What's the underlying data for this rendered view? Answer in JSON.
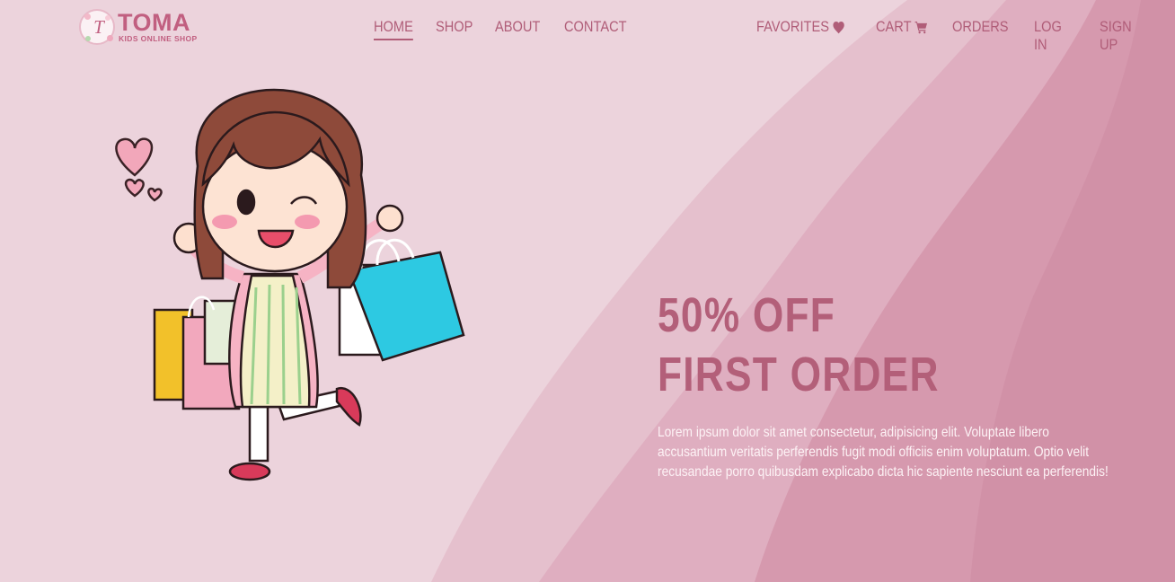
{
  "brand": {
    "name": "TOMA",
    "tagline": "KIDS ONLINE SHOP",
    "logo_letter": "T"
  },
  "nav": {
    "main": [
      {
        "label": "HOME",
        "active": true
      },
      {
        "label": "SHOP"
      },
      {
        "label": "ABOUT"
      },
      {
        "label": "CONTACT"
      }
    ],
    "account": [
      {
        "label": "FAVORITES",
        "icon": "heart-icon"
      },
      {
        "label": "CART",
        "icon": "cart-icon"
      },
      {
        "label": "ORDERS"
      },
      {
        "label": "LOG IN"
      },
      {
        "label": "SIGN UP"
      }
    ]
  },
  "hero": {
    "headline_line1": "50% OFF",
    "headline_line2": "FIRST ORDER",
    "body": "Lorem ipsum dolor sit amet consectetur, adipisicing elit. Voluptate libero accusantium veritatis perferendis fugit modi officiis enim voluptatum. Optio velit recusandae porro quibusdam explicabo dicta hic sapiente nesciunt ea perferendis!",
    "illustration": "girl-with-shopping-bags-illustration"
  },
  "colors": {
    "accent": "#b05d78",
    "background": "#ecd3dc",
    "wave_light": "#e3b9c7",
    "wave_mid": "#d9a3b6",
    "wave_dark": "#cf8fa6",
    "text_light": "#fdf2f5"
  }
}
